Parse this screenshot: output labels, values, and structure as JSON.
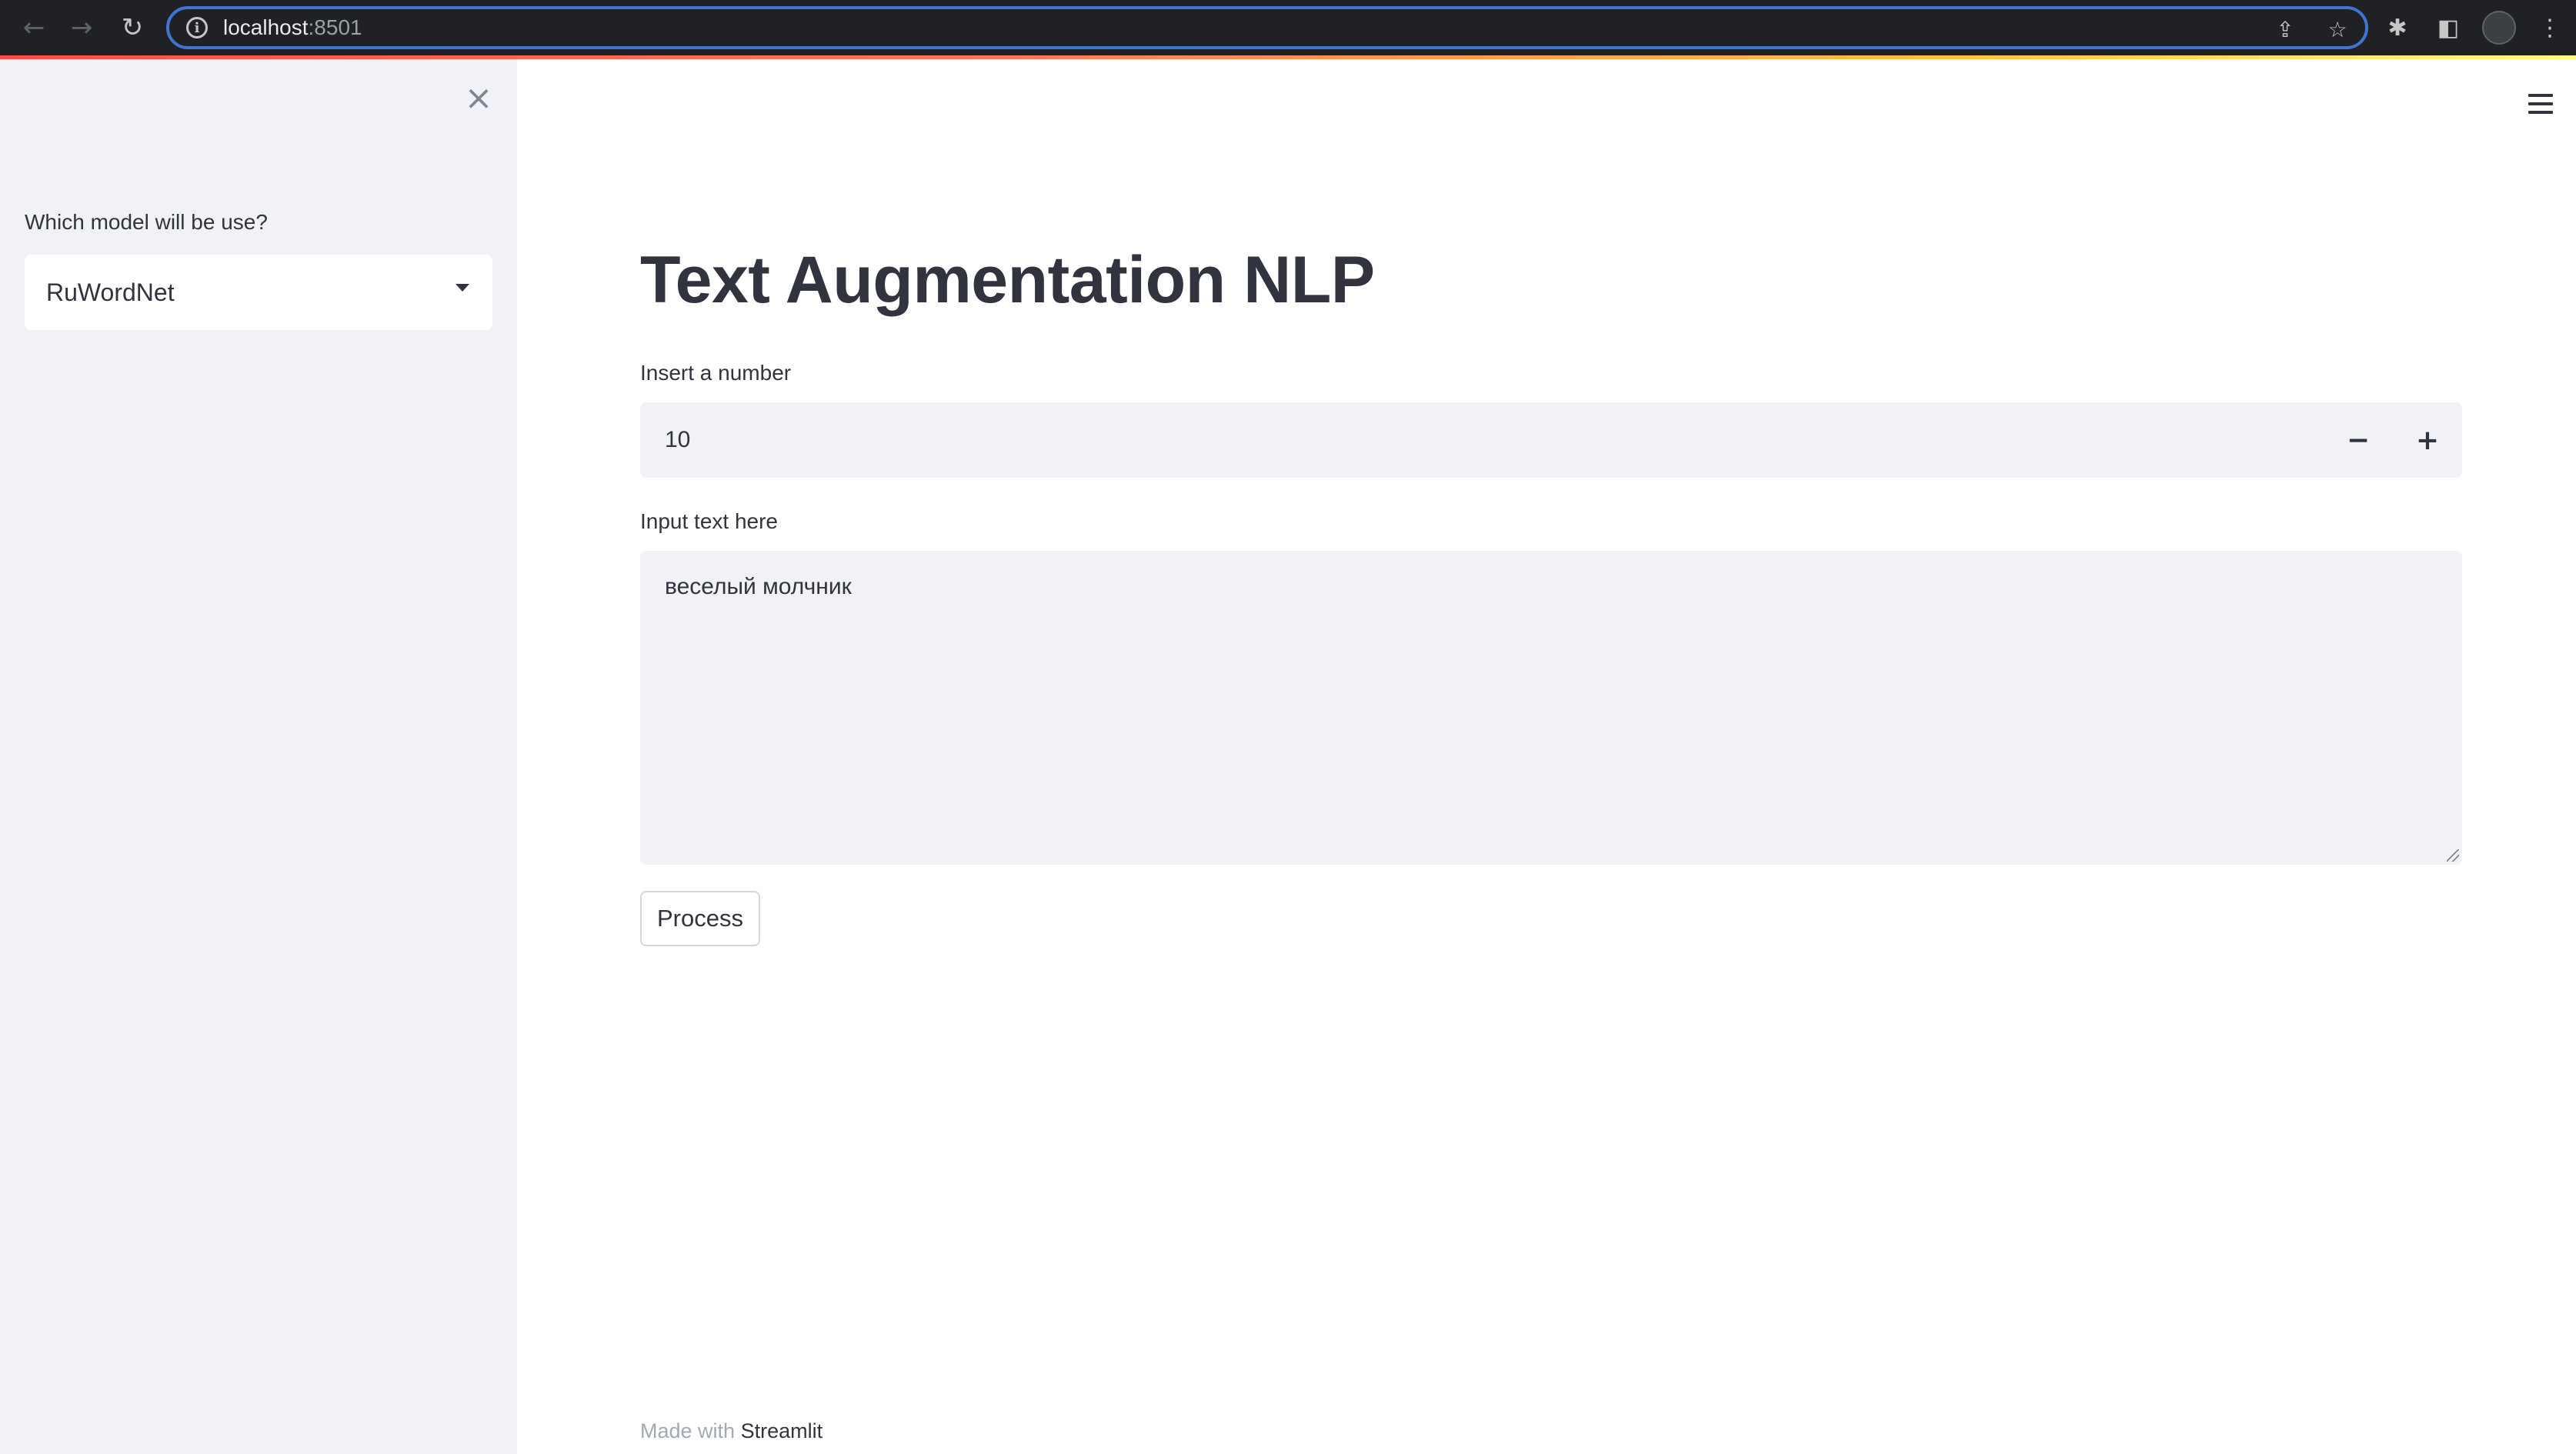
{
  "browser": {
    "url_host": "localhost",
    "url_port": ":8501",
    "back_icon": "←",
    "forward_icon": "→",
    "reload_icon": "↻",
    "info_icon": "i",
    "share_icon": "⇪",
    "star_icon": "☆",
    "extensions_icon": "✱",
    "sidepanel_icon": "◧",
    "menu_icon": "⋮"
  },
  "sidebar": {
    "close_icon": "×",
    "select_label": "Which model will be use?",
    "select_value": "RuWordNet"
  },
  "main": {
    "title": "Text Augmentation NLP",
    "number_label": "Insert a number",
    "number_value": "10",
    "decrement": "−",
    "increment": "+",
    "text_label": "Input text here",
    "text_value": "веселый молчник",
    "process_label": "Process"
  },
  "footer": {
    "made_with": "Made with ",
    "brand": "Streamlit"
  },
  "colors": {
    "accent_border": "#3f74d4",
    "sidebar_bg": "#f0f2f6",
    "text": "#31333f"
  }
}
